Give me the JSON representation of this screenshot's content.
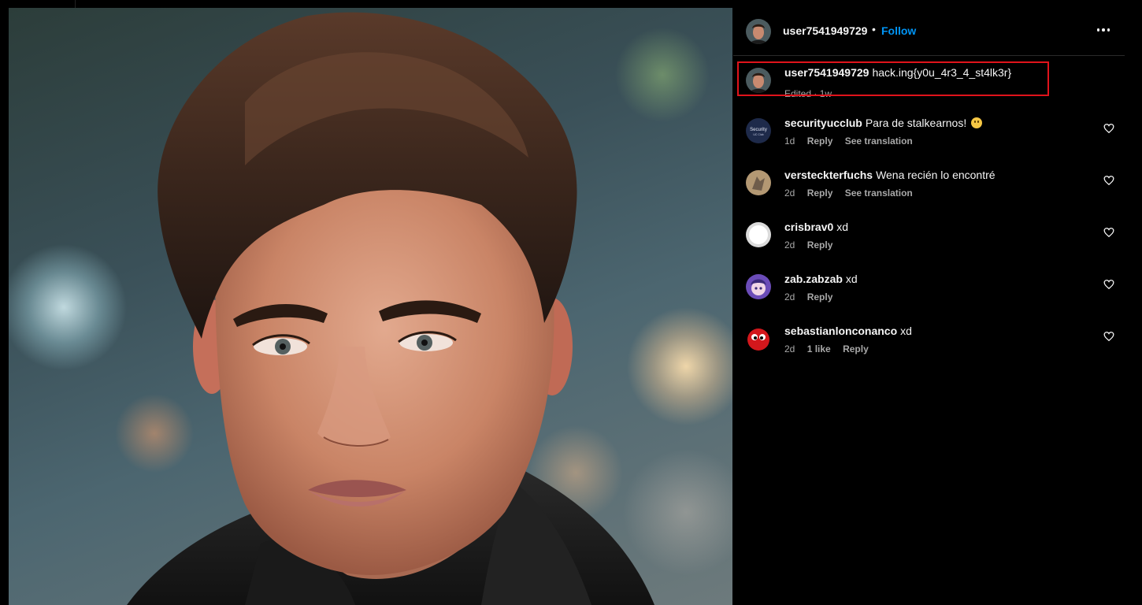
{
  "post": {
    "photo_alt": "portrait photo",
    "author": {
      "username": "user7541949729",
      "separator": "•",
      "follow_label": "Follow"
    },
    "more_icon": "more-options-icon"
  },
  "caption": {
    "username": "user7541949729",
    "text": "hack.ing{y0u_4r3_4_st4lk3r}",
    "meta": "Edited · 1w"
  },
  "comments": [
    {
      "username": "securityucclub",
      "text": "Para de stalkearnos!",
      "emoji": "confused-face-emoji",
      "time": "1d",
      "likes": "",
      "reply_label": "Reply",
      "translate_label": "See translation"
    },
    {
      "username": "versteckterfuchs",
      "text": "Wena recién lo encontré",
      "time": "2d",
      "likes": "",
      "reply_label": "Reply",
      "translate_label": "See translation"
    },
    {
      "username": "crisbrav0",
      "text": "xd",
      "time": "2d",
      "likes": "",
      "reply_label": "Reply",
      "translate_label": ""
    },
    {
      "username": "zab.zabzab",
      "text": "xd",
      "time": "2d",
      "likes": "",
      "reply_label": "Reply",
      "translate_label": ""
    },
    {
      "username": "sebastianlonconanco",
      "text": "xd",
      "time": "2d",
      "likes": "1 like",
      "reply_label": "Reply",
      "translate_label": ""
    }
  ],
  "colors": {
    "background": "#000000",
    "text": "#f5f5f5",
    "secondary_text": "#a8a8a8",
    "follow_blue": "#0095f6",
    "highlight_red": "#e0131b"
  },
  "icons": {
    "like": "heart-outline-icon",
    "more": "more-options-icon"
  }
}
